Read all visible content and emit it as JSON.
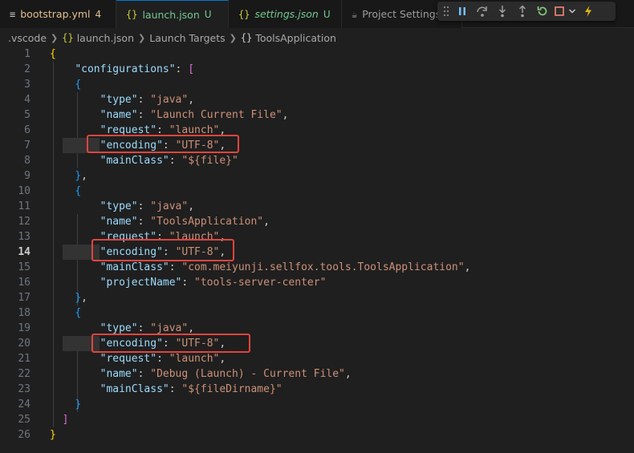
{
  "tabs": [
    {
      "icon": "≡",
      "name": "bootstrap.yml",
      "badge": "4",
      "state": "modified"
    },
    {
      "icon": "{}",
      "name": "launch.json",
      "badge": "U",
      "state": "active-untracked"
    },
    {
      "icon": "{}",
      "name": "settings.json",
      "badge": "U",
      "state": "untracked-italic"
    },
    {
      "icon": "☕",
      "name": "Project Settings",
      "badge": "",
      "state": "inactive"
    }
  ],
  "breadcrumb": [
    ".vscode",
    "launch.json",
    "Launch Targets",
    "ToolsApplication"
  ],
  "editor": {
    "current_line": "14",
    "lines": [
      {
        "n": "1",
        "t": [
          [
            "{",
            "brace"
          ]
        ]
      },
      {
        "n": "2",
        "t": [
          [
            "    ",
            "p"
          ],
          [
            "\"configurations\"",
            "key"
          ],
          [
            ": ",
            "p"
          ],
          [
            "[",
            "bracket"
          ]
        ]
      },
      {
        "n": "3",
        "t": [
          [
            "    ",
            "p"
          ],
          [
            "{",
            "brace2"
          ]
        ]
      },
      {
        "n": "4",
        "t": [
          [
            "        ",
            "p"
          ],
          [
            "\"type\"",
            "key"
          ],
          [
            ": ",
            "p"
          ],
          [
            "\"java\"",
            "str"
          ],
          [
            ",",
            "p"
          ]
        ]
      },
      {
        "n": "5",
        "t": [
          [
            "        ",
            "p"
          ],
          [
            "\"name\"",
            "key"
          ],
          [
            ": ",
            "p"
          ],
          [
            "\"Launch Current File\"",
            "str"
          ],
          [
            ",",
            "p"
          ]
        ]
      },
      {
        "n": "6",
        "t": [
          [
            "        ",
            "p"
          ],
          [
            "\"request\"",
            "key"
          ],
          [
            ": ",
            "p"
          ],
          [
            "\"launch\"",
            "str"
          ],
          [
            ",",
            "p"
          ]
        ]
      },
      {
        "n": "7",
        "t": [
          [
            "        ",
            "p"
          ],
          [
            "\"encoding\"",
            "key"
          ],
          [
            ": ",
            "p"
          ],
          [
            "\"UTF-8\"",
            "str"
          ],
          [
            ",",
            "p"
          ]
        ]
      },
      {
        "n": "8",
        "t": [
          [
            "        ",
            "p"
          ],
          [
            "\"mainClass\"",
            "key"
          ],
          [
            ": ",
            "p"
          ],
          [
            "\"${file}\"",
            "str"
          ]
        ]
      },
      {
        "n": "9",
        "t": [
          [
            "    ",
            "p"
          ],
          [
            "}",
            "brace2"
          ],
          [
            ",",
            "p"
          ]
        ]
      },
      {
        "n": "10",
        "t": [
          [
            "    ",
            "p"
          ],
          [
            "{",
            "brace2"
          ]
        ]
      },
      {
        "n": "11",
        "t": [
          [
            "        ",
            "p"
          ],
          [
            "\"type\"",
            "key"
          ],
          [
            ": ",
            "p"
          ],
          [
            "\"java\"",
            "str"
          ],
          [
            ",",
            "p"
          ]
        ]
      },
      {
        "n": "12",
        "t": [
          [
            "        ",
            "p"
          ],
          [
            "\"name\"",
            "key"
          ],
          [
            ": ",
            "p"
          ],
          [
            "\"ToolsApplication\"",
            "str"
          ],
          [
            ",",
            "p"
          ]
        ]
      },
      {
        "n": "13",
        "t": [
          [
            "        ",
            "p"
          ],
          [
            "\"request\"",
            "key"
          ],
          [
            ": ",
            "p"
          ],
          [
            "\"launch\"",
            "str"
          ],
          [
            ",",
            "p"
          ]
        ]
      },
      {
        "n": "14",
        "t": [
          [
            "        ",
            "p"
          ],
          [
            "\"encoding\"",
            "key"
          ],
          [
            ": ",
            "p"
          ],
          [
            "\"UTF-8\"",
            "str"
          ],
          [
            ",",
            "p"
          ]
        ]
      },
      {
        "n": "15",
        "t": [
          [
            "        ",
            "p"
          ],
          [
            "\"mainClass\"",
            "key"
          ],
          [
            ": ",
            "p"
          ],
          [
            "\"com.meiyunji.sellfox.tools.ToolsApplication\"",
            "str"
          ],
          [
            ",",
            "p"
          ]
        ]
      },
      {
        "n": "16",
        "t": [
          [
            "        ",
            "p"
          ],
          [
            "\"projectName\"",
            "key"
          ],
          [
            ": ",
            "p"
          ],
          [
            "\"tools-server-center\"",
            "str"
          ]
        ]
      },
      {
        "n": "17",
        "t": [
          [
            "    ",
            "p"
          ],
          [
            "}",
            "brace2"
          ],
          [
            ",",
            "p"
          ]
        ]
      },
      {
        "n": "18",
        "t": [
          [
            "    ",
            "p"
          ],
          [
            "{",
            "brace2"
          ]
        ]
      },
      {
        "n": "19",
        "t": [
          [
            "        ",
            "p"
          ],
          [
            "\"type\"",
            "key"
          ],
          [
            ": ",
            "p"
          ],
          [
            "\"java\"",
            "str"
          ],
          [
            ",",
            "p"
          ]
        ]
      },
      {
        "n": "20",
        "t": [
          [
            "        ",
            "p"
          ],
          [
            "\"encoding\"",
            "key"
          ],
          [
            ": ",
            "p"
          ],
          [
            "\"UTF-8\"",
            "str"
          ],
          [
            ",",
            "p"
          ]
        ]
      },
      {
        "n": "21",
        "t": [
          [
            "        ",
            "p"
          ],
          [
            "\"request\"",
            "key"
          ],
          [
            ": ",
            "p"
          ],
          [
            "\"launch\"",
            "str"
          ],
          [
            ",",
            "p"
          ]
        ]
      },
      {
        "n": "22",
        "t": [
          [
            "        ",
            "p"
          ],
          [
            "\"name\"",
            "key"
          ],
          [
            ": ",
            "p"
          ],
          [
            "\"Debug (Launch) - Current File\"",
            "str"
          ],
          [
            ",",
            "p"
          ]
        ]
      },
      {
        "n": "23",
        "t": [
          [
            "        ",
            "p"
          ],
          [
            "\"mainClass\"",
            "key"
          ],
          [
            ": ",
            "p"
          ],
          [
            "\"${fileDirname}\"",
            "str"
          ]
        ]
      },
      {
        "n": "24",
        "t": [
          [
            "    ",
            "p"
          ],
          [
            "}",
            "brace2"
          ]
        ]
      },
      {
        "n": "25",
        "t": [
          [
            "  ",
            "p"
          ],
          [
            "]",
            "bracket"
          ]
        ]
      },
      {
        "n": "26",
        "t": [
          [
            "}",
            "brace"
          ]
        ]
      }
    ],
    "highlighted_lines": [
      "7",
      "14",
      "20"
    ]
  },
  "colors": {
    "accent": "#0078d4",
    "highlight_box": "#e0443e",
    "key": "#9cdcfe",
    "string": "#ce9178",
    "modified": "#e2c08d",
    "untracked": "#73c991"
  },
  "debug_toolbar": [
    "grip-icon",
    "pause-icon",
    "step-over-icon",
    "step-into-icon",
    "step-out-icon",
    "restart-icon",
    "stop-icon",
    "chevron-down-icon",
    "hot-code-replace-icon"
  ]
}
